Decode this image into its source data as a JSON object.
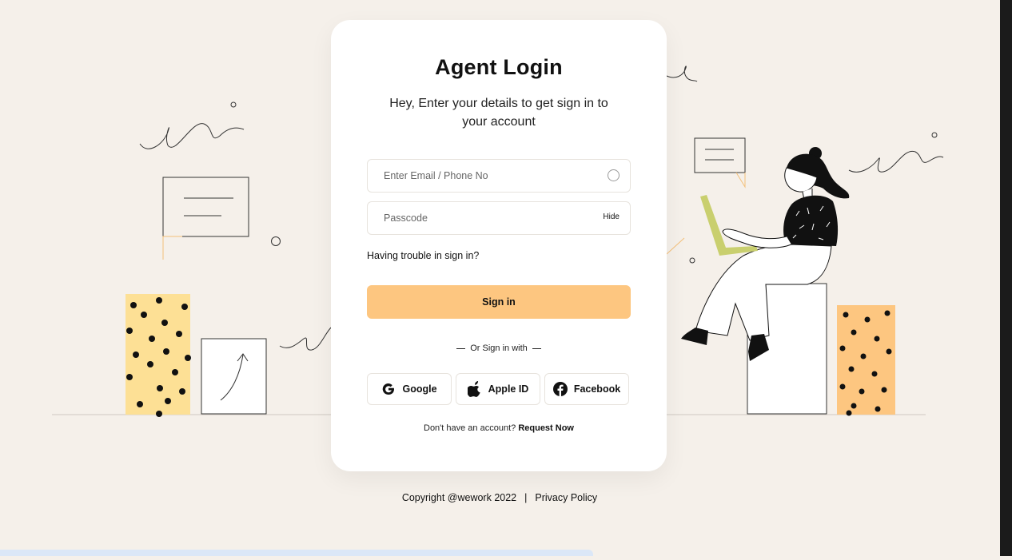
{
  "login": {
    "title": "Agent Login",
    "subtitle": "Hey, Enter your details to get sign in to your account",
    "email_placeholder": "Enter Email / Phone No",
    "passcode_placeholder": "Passcode",
    "hide_label": "Hide",
    "trouble_text": "Having trouble in sign in?",
    "signin_label": "Sign in",
    "divider_text": "Or Sign in with",
    "social": {
      "google": "Google",
      "apple": "Apple ID",
      "facebook": "Facebook"
    },
    "request_prompt": "Don't have an account?",
    "request_link": "Request Now"
  },
  "footer": {
    "copyright": "Copyright @wework 2022",
    "separator": "|",
    "privacy": "Privacy Policy"
  },
  "colors": {
    "background": "#f5f0ea",
    "accent": "#fdc680",
    "card": "#ffffff",
    "yellow_block": "#fde095",
    "orange_block": "#fdc680",
    "laptop": "#c9cf6e"
  }
}
